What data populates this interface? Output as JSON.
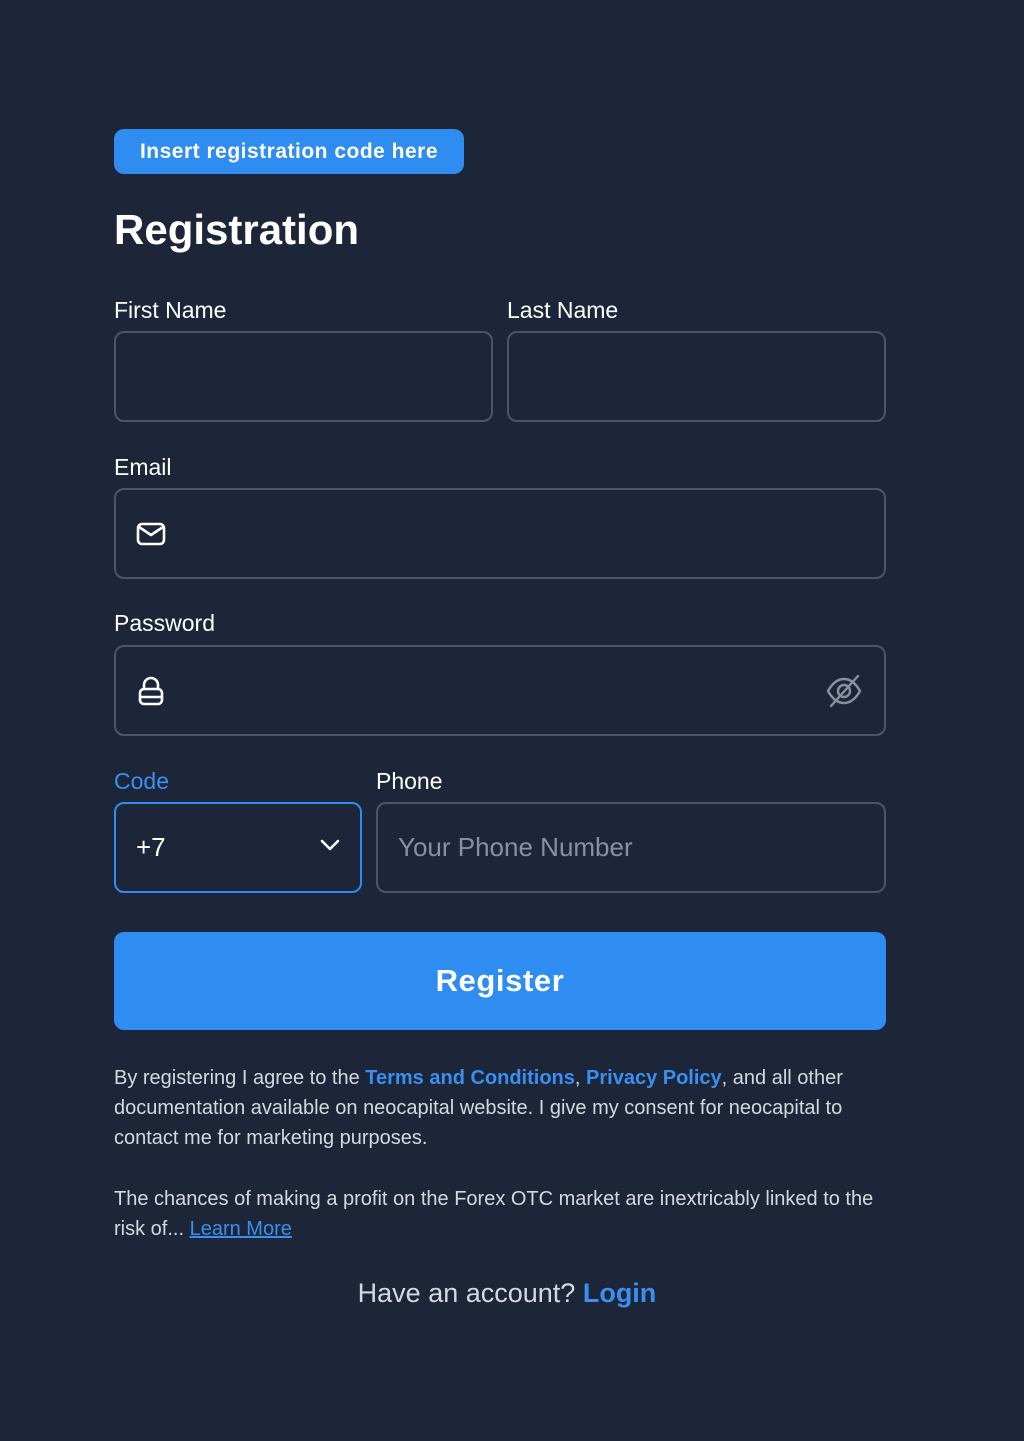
{
  "registration_code_button": {
    "label": "Insert registration code here"
  },
  "title": "Registration",
  "fields": {
    "first_name": {
      "label": "First Name",
      "value": "",
      "placeholder": ""
    },
    "last_name": {
      "label": "Last Name",
      "value": "",
      "placeholder": ""
    },
    "email": {
      "label": "Email",
      "value": "",
      "placeholder": "",
      "icon": "mail-icon"
    },
    "password": {
      "label": "Password",
      "value": "",
      "placeholder": "",
      "icon": "lock-icon",
      "toggle_icon": "eye-off-icon"
    },
    "code": {
      "label": "Code",
      "selected": "+7",
      "icon": "chevron-down-icon"
    },
    "phone": {
      "label": "Phone",
      "value": "",
      "placeholder": "Your Phone Number"
    }
  },
  "register_button": {
    "label": "Register"
  },
  "consent": {
    "prefix": "By registering I agree to the ",
    "terms_link": "Terms and Conditions",
    "separator": ", ",
    "privacy_link": "Privacy Policy",
    "suffix": ", and all other documentation available on neocapital website. I give my consent for neocapital to contact me for marketing purposes."
  },
  "risk": {
    "text": "The chances of making a profit on the Forex OTC market are inextricably linked to the risk of... ",
    "learn_more_link": "Learn More"
  },
  "account": {
    "prompt": "Have an account? ",
    "login_link": "Login"
  },
  "colors": {
    "background": "#1c2638",
    "accent": "#2f8cf0",
    "input_border": "#4a5568",
    "muted_text": "#d4d8e0"
  }
}
